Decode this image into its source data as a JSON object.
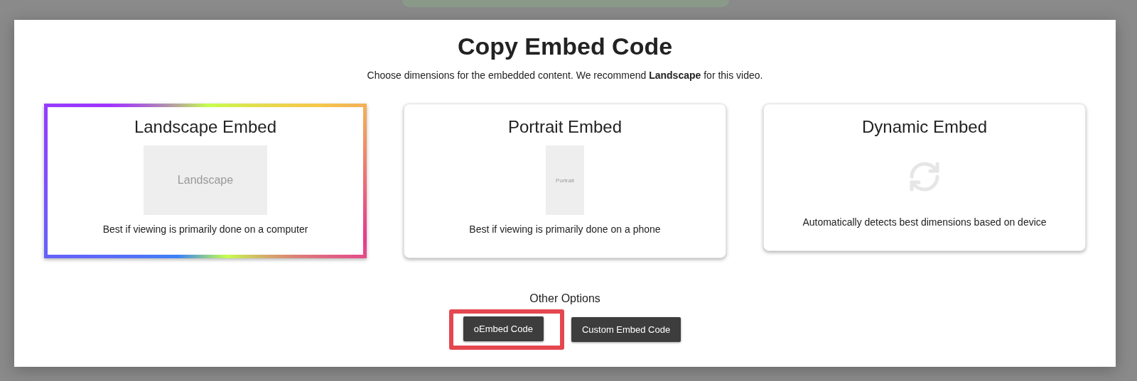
{
  "dialog": {
    "title": "Copy Embed Code",
    "subtitle": "Choose dimensions for the embedded content. We recommend **Landscape** for this video."
  },
  "options": [
    {
      "title": "Landscape Embed",
      "selected": true,
      "preview": {
        "kind": "landscape",
        "label": "Landscape"
      },
      "description": "Best if viewing is primarily done on a computer"
    },
    {
      "title": "Portrait Embed",
      "selected": false,
      "preview": {
        "kind": "portrait",
        "label": "Portrait"
      },
      "description": "Best if viewing is primarily done on a phone"
    },
    {
      "title": "Dynamic Embed",
      "selected": false,
      "preview": {
        "kind": "sync-icon"
      },
      "description": "Automatically detects best dimensions based on device"
    }
  ],
  "other_options": {
    "heading": "Other Options",
    "buttons": [
      {
        "label": "oEmbed Code",
        "highlighted": true
      },
      {
        "label": "Custom Embed Code",
        "highlighted": false
      }
    ]
  }
}
